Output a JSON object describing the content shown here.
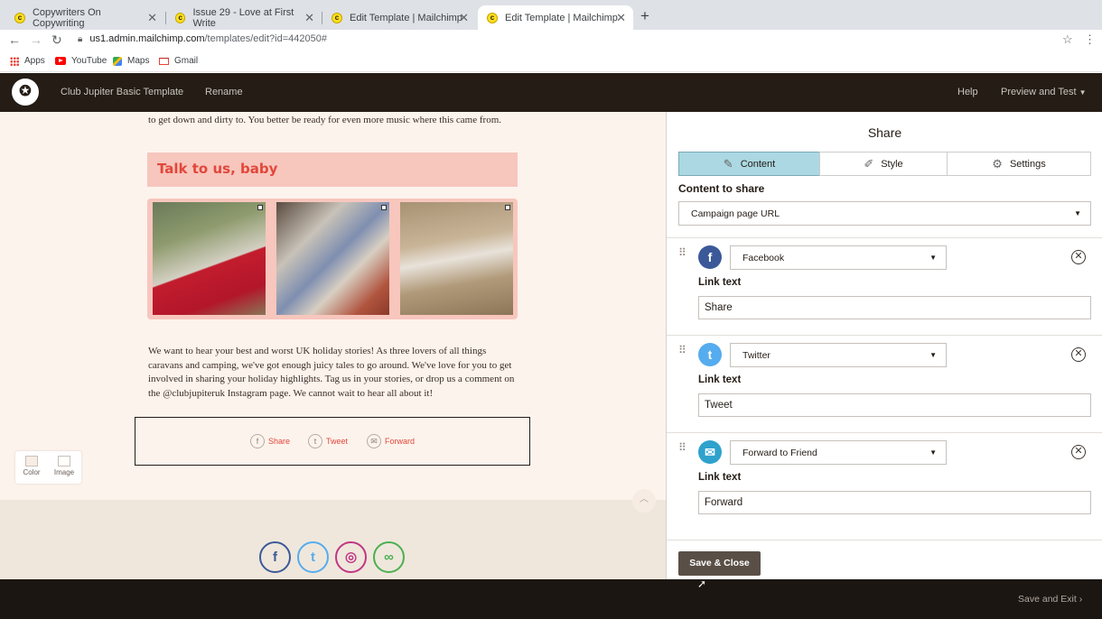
{
  "browser": {
    "tabs": [
      {
        "title": "Copywriters On Copywriting"
      },
      {
        "title": "Issue 29 - Love at First Write"
      },
      {
        "title": "Edit Template | Mailchimp"
      },
      {
        "title": "Edit Template | Mailchimp"
      }
    ],
    "url_host": "us1.admin.mailchimp.com",
    "url_path": "/templates/edit?id=442050#",
    "bookmarks": [
      "Apps",
      "YouTube",
      "Maps",
      "Gmail"
    ]
  },
  "header": {
    "template_name": "Club Jupiter Basic Template",
    "rename": "Rename",
    "help": "Help",
    "preview": "Preview and Test"
  },
  "canvas": {
    "top_text": "to get down and dirty to. You better be ready for even more music where this came from.",
    "section_title": "Talk to us, baby",
    "body_text": "We want to hear your best and worst UK holiday stories! As three lovers of all things caravans and camping, we've got enough juicy tales to go around. We've love for you to get involved in sharing your holiday highlights. Tag us in your stories, or drop us a comment on the @clubjupiteruk Instagram page. We cannot wait to hear all about it!",
    "share_items": [
      "Share",
      "Tweet",
      "Forward"
    ],
    "tools": [
      "Color",
      "Image"
    ]
  },
  "panel": {
    "title": "Share",
    "tabs": [
      "Content",
      "Style",
      "Settings"
    ],
    "content_to_share_label": "Content to share",
    "content_to_share_value": "Campaign page URL",
    "link_text_label": "Link text",
    "networks": [
      {
        "name": "Facebook",
        "link_text": "Share",
        "color": "#3b5998"
      },
      {
        "name": "Twitter",
        "link_text": "Tweet",
        "color": "#55acee"
      },
      {
        "name": "Forward to Friend",
        "link_text": "Forward",
        "color": "#2ea2cc"
      }
    ],
    "save_close": "Save & Close"
  },
  "footer": {
    "save_exit": "Save and Exit"
  }
}
